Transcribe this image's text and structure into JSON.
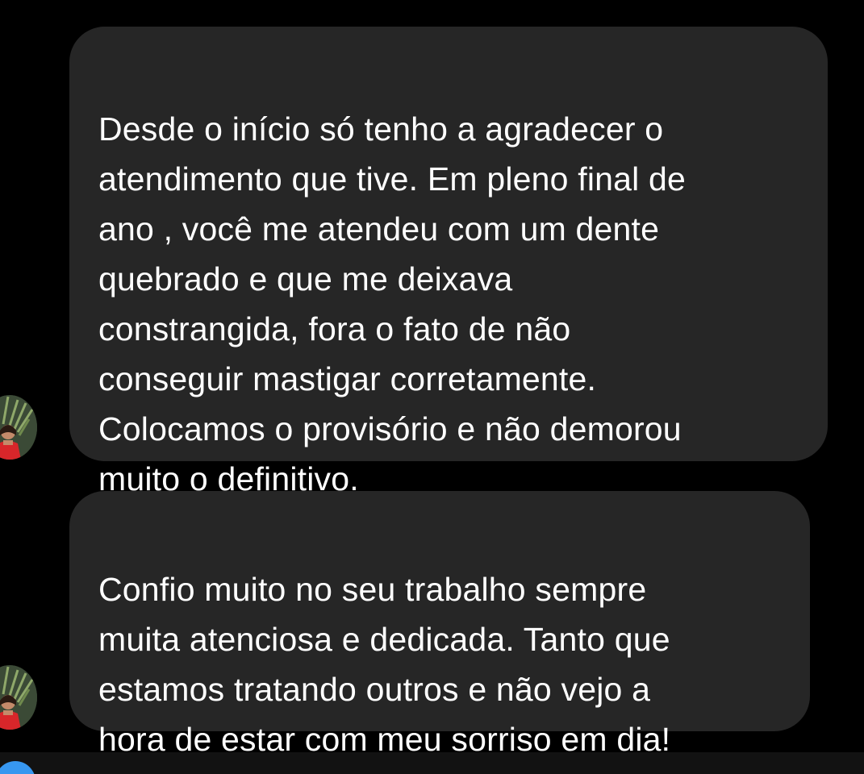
{
  "conversation": {
    "messages": [
      {
        "text": "Desde o início só tenho a agradecer o\natendimento que tive. Em pleno final de\nano , você me atendeu com um dente\nquebrado e que me deixava\nconstrangida, fora o fato de não\nconseguir mastigar corretamente.\nColocamos o provisório e não demorou\nmuito o definitivo."
      },
      {
        "text": "Confio muito no seu trabalho sempre\nmuita atenciosa e dedicada. Tanto que\nestamos tratando outros e não vejo a\nhora de estar com meu sorriso em dia!"
      }
    ]
  },
  "icons": {
    "avatar": "sender-avatar-icon",
    "compose": "composer-button-icon"
  },
  "colors": {
    "background": "#000000",
    "bubble": "#262626",
    "text": "#ffffff",
    "accent": "#3797f0"
  }
}
